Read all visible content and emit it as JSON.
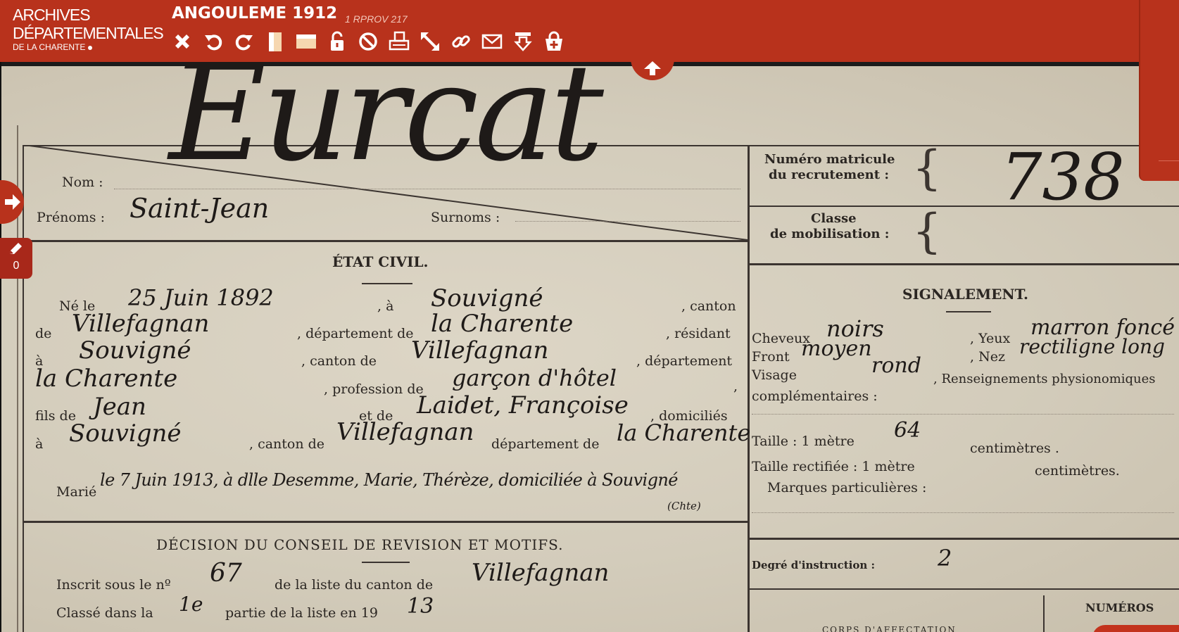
{
  "header": {
    "logo": {
      "line1": "ARCHIVES",
      "line2": "DÉPARTEMENTALES",
      "line3": "DE LA CHARENTE"
    },
    "title": "ANGOULEME 1912",
    "cote": "1 RPROV 217"
  },
  "toolbar": [
    {
      "name": "close-icon"
    },
    {
      "name": "rotate-left-icon"
    },
    {
      "name": "rotate-right-icon"
    },
    {
      "name": "single-page-icon"
    },
    {
      "name": "full-width-icon"
    },
    {
      "name": "unlock-icon"
    },
    {
      "name": "prohibited-icon"
    },
    {
      "name": "print-icon"
    },
    {
      "name": "resize-icon"
    },
    {
      "name": "link-icon"
    },
    {
      "name": "mail-icon"
    },
    {
      "name": "download-icon"
    },
    {
      "name": "add-to-basket-icon"
    }
  ],
  "annotations": {
    "count": "0"
  },
  "colors": {
    "brand": "#b8321c",
    "paper": "#d7d0c0"
  },
  "document": {
    "surname": "Eurcat",
    "labels": {
      "nom": "Nom :",
      "prenoms": "Prénoms :",
      "surnoms": "Surnoms :",
      "matricule1": "Numéro matricule",
      "matricule2": "du recrutement :",
      "classe1": "Classe",
      "classe2": "de mobilisation :",
      "etat_civil": "ÉTAT CIVIL.",
      "signalement": "SIGNALEMENT.",
      "ne_le": "Né le",
      "a": ", à",
      "canton": ", canton",
      "de": "de",
      "departement_de": ", département de",
      "residant": ", résidant",
      "a2": "à",
      "canton_de": ", canton de",
      "departement": ", département",
      "profession_de": ", profession de",
      "comma": ",",
      "fils_de": "fils de",
      "et_de": "et de",
      "domicilies": ", domiciliés",
      "a3": "à",
      "canton_de2": ", canton de",
      "departement_de2": "département de",
      "marie": "Marié",
      "cheveux": "Cheveux",
      "yeux": ", Yeux",
      "front": "Front",
      "nez": ", Nez",
      "visage": "Visage",
      "renseignements": ", Renseignements physionomiques",
      "complementaires": "complémentaires :",
      "taille": "Taille : 1 mètre",
      "centimetres": "centimètres .",
      "taille_rect": "Taille rectifiée : 1 mètre",
      "centimetres2": "centimètres.",
      "marques": "Marques particulières :",
      "degre": "Degré d'instruction :",
      "decision": "DÉCISION DU CONSEIL DE REVISION ET MOTIFS.",
      "inscrit": "Inscrit sous le nº",
      "liste_canton": "de la liste du canton de",
      "classe_dans": "Classé dans la",
      "partie_liste": "partie de la liste en 19",
      "numeros": "NUMÉROS",
      "corps": "CORPS D'AFFECTATION"
    },
    "values": {
      "prenoms": "Saint-Jean",
      "matricule": "738",
      "ne_date": "25 Juin 1892",
      "ne_lieu": "Souvigné",
      "canton_naiss": "Villefagnan",
      "dept_naiss": "la Charente",
      "residence": "Souvigné",
      "canton_res": "Villefagnan",
      "dept_res": "la Charente",
      "profession": "garçon d'hôtel",
      "pere": "Jean",
      "mere": "Laidet, Françoise",
      "domicile": "Souvigné",
      "canton_dom": "Villefagnan",
      "dept_dom": "la Charente",
      "mariage": "le 7 Juin 1913, à dlle Desemme, Marie, Thérèze, domiciliée à Souvigné",
      "mariage_note": "(Chte)",
      "cheveux": "noirs",
      "yeux": "marron foncé",
      "front": "moyen",
      "nez": "rectiligne long",
      "visage": "rond",
      "taille_cm": "64",
      "degre": "2",
      "inscrit_no": "67",
      "canton_liste": "Villefagnan",
      "partie": "1e",
      "annee": "13"
    }
  }
}
